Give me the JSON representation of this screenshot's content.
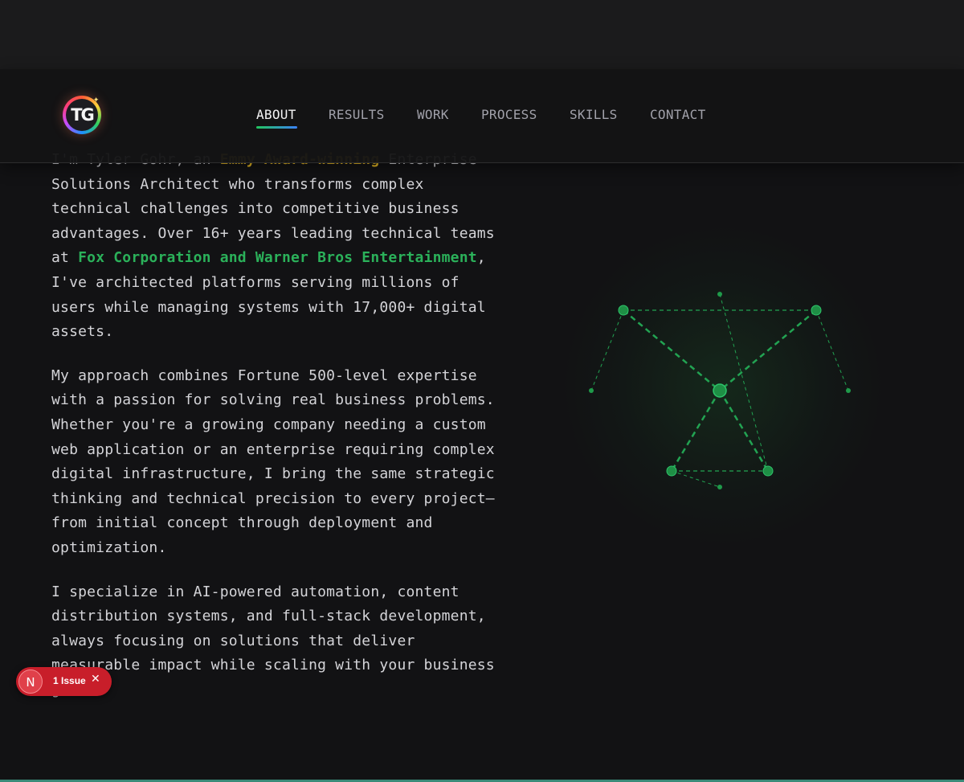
{
  "nav": {
    "logo_text": "TG",
    "items": [
      {
        "label": "ABOUT",
        "active": true
      },
      {
        "label": "RESULTS"
      },
      {
        "label": "WORK"
      },
      {
        "label": "PROCESS"
      },
      {
        "label": "SKILLS"
      },
      {
        "label": "CONTACT"
      }
    ]
  },
  "about": {
    "p1_lead": "I'm Tyler Gohr, an ",
    "p1_award": "Emmy Award-winning",
    "p1_mid": " Enterprise Solutions Architect who transforms complex technical challenges into competitive business advantages. Over 16+ years leading technical teams at ",
    "p1_companies": "Fox Corporation and Warner Bros Entertainment",
    "p1_end": ", I've architected platforms serving millions of users while managing systems with 17,000+ digital assets.",
    "p2": "My approach combines Fortune 500-level expertise with a passion for solving real business problems. Whether you're a growing company needing a custom web application or an enterprise requiring complex digital infrastructure, I bring the same strategic thinking and technical precision to every project—from initial concept through deployment and optimization.",
    "p3": "I specialize in AI-powered automation, content distribution systems, and full-stack development, always focusing on solutions that deliver measurable impact while scaling with your business goals."
  },
  "issue_badge": {
    "icon_letter": "N",
    "text": "1 Issue"
  },
  "colors": {
    "accent_green": "#2bb15a",
    "accent_yellow": "#e8b923",
    "nav_underline_start": "#22c55e",
    "nav_underline_end": "#3b82f6",
    "issue_red": "#c81e2a"
  }
}
